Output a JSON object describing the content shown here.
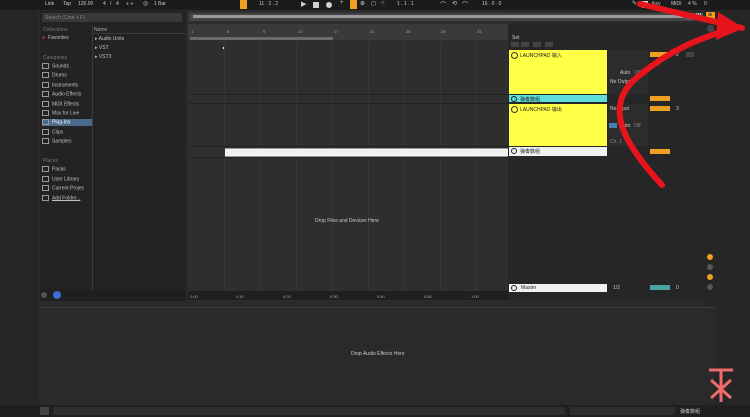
{
  "transport": {
    "link": "Link",
    "tap": "Tap",
    "tempo": "126.00",
    "meter_num": "4",
    "meter_sep": "/",
    "meter_den": "4",
    "metronome_dots": "● ●",
    "quantize": "1 Bar",
    "position": "11 .  3 .  2",
    "loop_start": "1 .  1 .  1",
    "loop_len": "16 .  0 .  0",
    "key_label": "Key",
    "midi_label": "MIDI",
    "cpu": "4 %",
    "cpu_disk": "0"
  },
  "browser": {
    "search_placeholder": "Search (Cmd + F)",
    "collections_label": "Collections",
    "favorites": "Favorites",
    "categories_label": "Categories",
    "categories": [
      "Sounds",
      "Drums",
      "Instruments",
      "Audio Effects",
      "MIDI Effects",
      "Max for Live",
      "Plug-Ins",
      "Clips",
      "Samples"
    ],
    "places_label": "Places",
    "places": [
      "Packs",
      "User Library",
      "Current Projec",
      "Add Folder..."
    ],
    "column_header": "Name",
    "items": [
      "Audio Units",
      "VST",
      "VST3"
    ]
  },
  "arrangement": {
    "ruler_bars": [
      "1",
      "5",
      "9",
      "13",
      "17",
      "21",
      "25",
      "29",
      "33"
    ],
    "time_marks": [
      "0:00",
      "0:10",
      "0:20",
      "0:30",
      "0:40",
      "0:50",
      "1:00"
    ],
    "drop_devices": "Drop Files and Devices Here"
  },
  "tracks": {
    "set_label": "Set",
    "track1_name": "LAUNCHPAD 输入",
    "track1_routing_out": "No Output",
    "track1_auto": "Auto",
    "track1_off": "Off",
    "track1_num": "2",
    "clip_label": "弹奏数组",
    "track2_name": "LAUNCHPAD 输出",
    "track2_routing_in": "No Input",
    "track2_auto": "Auto",
    "track2_off": "Off",
    "track2_num": "3",
    "ch_label": "Ch. 1",
    "clip2_label": "弹奏数组",
    "master_label": "Master",
    "master_fraction": "1/2",
    "master_num": "0"
  },
  "detail": {
    "drop_effects": "Drop Audio Effects Here",
    "status_track": "弹奏数组"
  },
  "colors": {
    "accent_orange": "#f0a020",
    "track_yellow": "#ffff45",
    "clip_cyan": "#5edcd9",
    "annotation_red": "#e8141c"
  }
}
